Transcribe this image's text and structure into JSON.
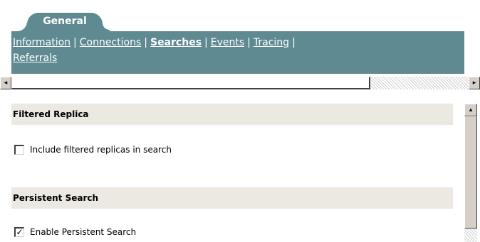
{
  "tab": {
    "label": "General"
  },
  "nav": {
    "links": [
      "Information",
      "Connections",
      "Searches",
      "Events",
      "Tracing",
      "Referrals"
    ],
    "active": "Searches",
    "separator": "|"
  },
  "scrollbar": {
    "left_arrow": "◂",
    "right_arrow": "▸",
    "up_arrow": "▴"
  },
  "sections": {
    "filtered_replica": {
      "title": "Filtered Replica",
      "option_label": "Include filtered replicas in search",
      "checked": false
    },
    "persistent_search": {
      "title": "Persistent Search",
      "option_label": "Enable Persistent Search",
      "checked": true,
      "check_mark": "✓"
    }
  },
  "colors": {
    "nav_background": "#5f8a92",
    "section_background": "#ece9e2"
  }
}
